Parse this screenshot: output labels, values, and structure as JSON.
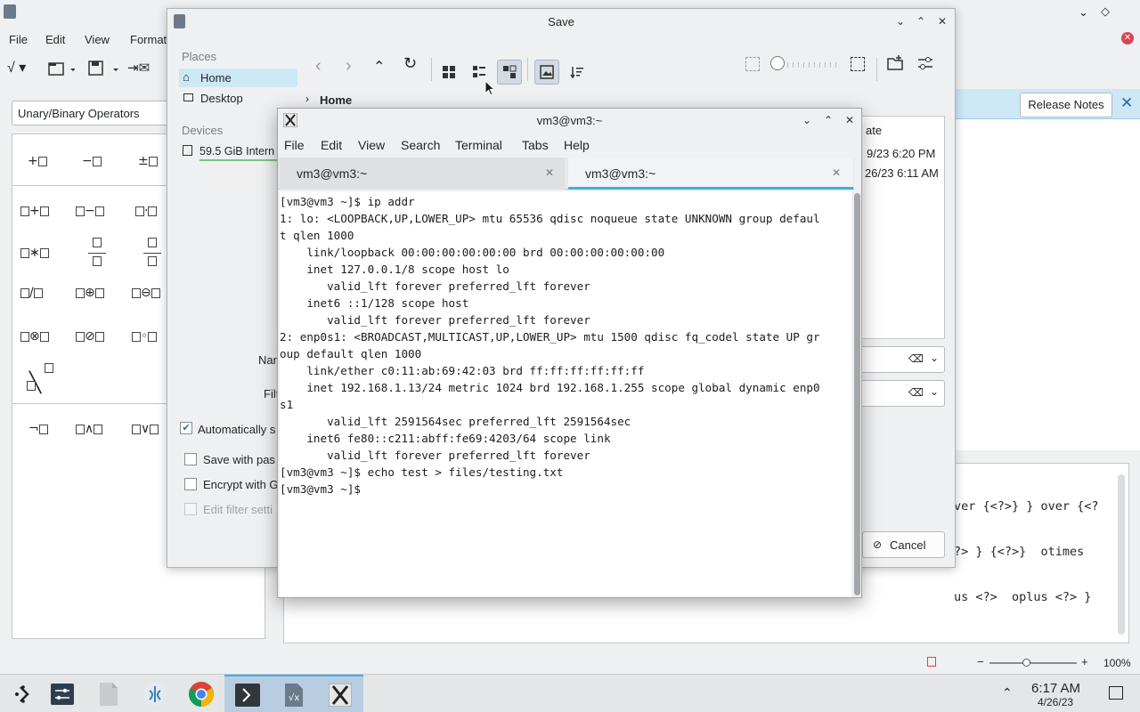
{
  "bg_app": {
    "menu": [
      "File",
      "Edit",
      "View",
      "Format"
    ],
    "category_select": "Unary/Binary Operators",
    "release_notes": "Release Notes",
    "formula_text": [
      "ver {<?>} } over {<?",
      "?> } {<?>}  otimes",
      "us <?>  oplus <?> }"
    ],
    "zoom_level": "100%",
    "status_zoom_fraction": 0.42
  },
  "save_dialog": {
    "title": "Save",
    "places_header": "Places",
    "places": [
      "Home",
      "Desktop"
    ],
    "devices_header": "Devices",
    "device": "59.5 GiB Intern",
    "breadcrumb": "Home",
    "column_header_partial": "ate",
    "rows_partial": [
      "9/23 6:20 PM",
      "26/23 6:11 AM"
    ],
    "name_label_partial": "Nar",
    "filter_label_partial": "Filt",
    "auto_ext_label": "Automatically s",
    "save_password_label": "Save with pas",
    "encrypt_label": "Encrypt with G",
    "edit_filter_label": "Edit filter setti",
    "cancel_label": "Cancel"
  },
  "terminal": {
    "title": "vm3@vm3:~",
    "menu": [
      "File",
      "Edit",
      "View",
      "Search",
      "Terminal",
      "Tabs",
      "Help"
    ],
    "tabs": [
      {
        "label": "vm3@vm3:~",
        "active": false
      },
      {
        "label": "vm3@vm3:~",
        "active": true
      }
    ],
    "lines": [
      "[vm3@vm3 ~]$ ip addr",
      "1: lo: <LOOPBACK,UP,LOWER_UP> mtu 65536 qdisc noqueue state UNKNOWN group defaul",
      "t qlen 1000",
      "    link/loopback 00:00:00:00:00:00 brd 00:00:00:00:00:00",
      "    inet 127.0.0.1/8 scope host lo",
      "       valid_lft forever preferred_lft forever",
      "    inet6 ::1/128 scope host",
      "       valid_lft forever preferred_lft forever",
      "2: enp0s1: <BROADCAST,MULTICAST,UP,LOWER_UP> mtu 1500 qdisc fq_codel state UP gr",
      "oup default qlen 1000",
      "    link/ether c0:11:ab:69:42:03 brd ff:ff:ff:ff:ff:ff",
      "    inet 192.168.1.13/24 metric 1024 brd 192.168.1.255 scope global dynamic enp0",
      "s1",
      "       valid_lft 2591564sec preferred_lft 2591564sec",
      "    inet6 fe80::c211:abff:fe69:4203/64 scope link",
      "       valid_lft forever preferred_lft forever",
      "[vm3@vm3 ~]$ echo test > files/testing.txt",
      "[vm3@vm3 ~]$ "
    ]
  },
  "taskbar": {
    "time": "6:17 AM",
    "date": "4/26/23"
  },
  "colors": {
    "accent": "#3daee9",
    "active_task": "#b9cde2"
  }
}
